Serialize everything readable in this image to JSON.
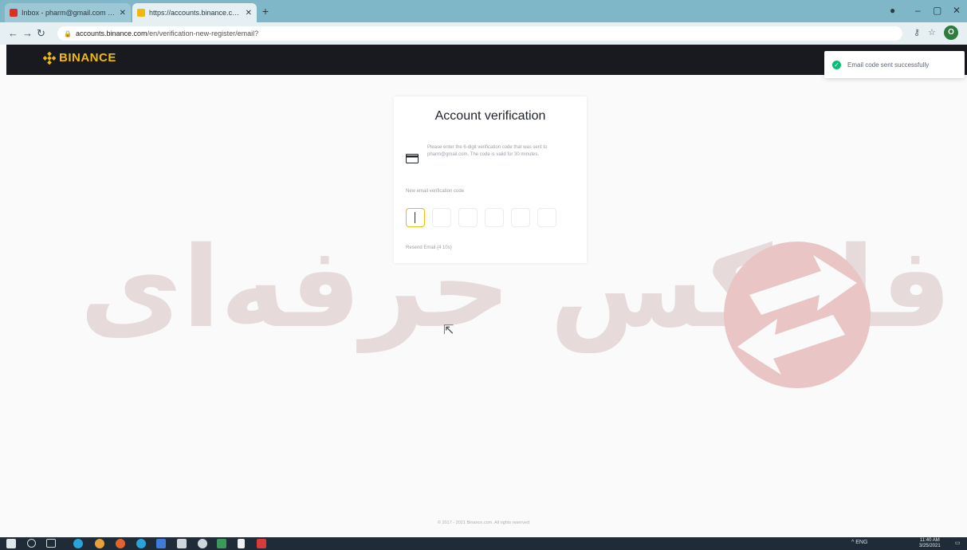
{
  "browser": {
    "tabs": [
      {
        "title": "Inbox - pharm@gmail.com - G",
        "active": false
      },
      {
        "title": "https://accounts.binance.com/e",
        "active": true
      }
    ],
    "address": {
      "host": "accounts.binance.com",
      "path": "/en/verification-new-register/email?"
    },
    "profile_initial": "O"
  },
  "header": {
    "brand": "BINANCE"
  },
  "toast": {
    "message": "Email code sent successfully"
  },
  "card": {
    "title": "Account verification",
    "description": "Please enter the 6-digit verification code that was sent to pharm@gmail.com. The code is valid for 30 minutes.",
    "code_label": "New email verification code",
    "code_digits": [
      "",
      "",
      "",
      "",
      "",
      ""
    ],
    "resend": "Resend Email (4 10s)"
  },
  "watermark": {
    "text": "فارکس حرفه‌ای"
  },
  "footer": {
    "copyright": "© 2017 - 2021 Binance.com. All rights reserved"
  },
  "taskbar": {
    "tray_text": "^  ENG",
    "time": "11:40 AM",
    "date": "3/25/2021"
  },
  "colors": {
    "brand": "#f0b90b",
    "header_bg": "#181a20",
    "success": "#02c076"
  }
}
